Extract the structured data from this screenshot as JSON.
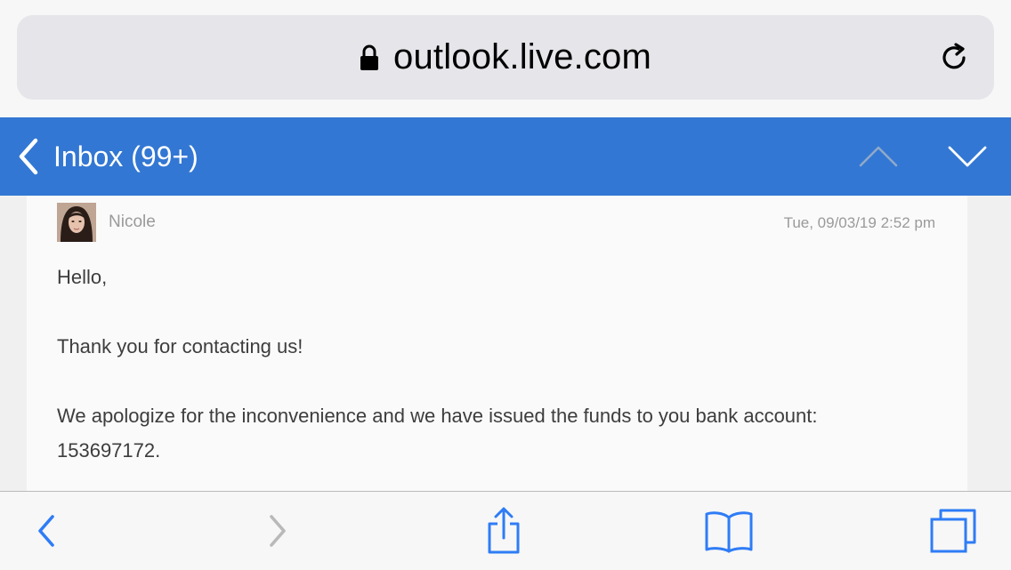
{
  "browser": {
    "url": "outlook.live.com",
    "icons": {
      "lock": "lock-icon",
      "reload": "reload-icon"
    }
  },
  "header": {
    "back_label": "Inbox (99+)",
    "accent": "#3277d3",
    "icons": {
      "back": "chevron-left-icon",
      "prev": "chevron-up-icon",
      "next": "chevron-down-icon"
    }
  },
  "message": {
    "sender": "Nicole",
    "date": "Tue, 09/03/19 2:52 pm",
    "body": {
      "greeting": "Hello,",
      "line1": "Thank you for contacting us!",
      "line2": "We apologize for the inconvenience and we have issued the funds to you bank account:",
      "line3": "153697172."
    }
  },
  "toolbar": {
    "items": [
      "back-icon",
      "forward-icon",
      "share-icon",
      "bookmarks-icon",
      "tabs-icon"
    ],
    "accent": "#2f7cf6",
    "disabled": "#b9b9b9"
  }
}
